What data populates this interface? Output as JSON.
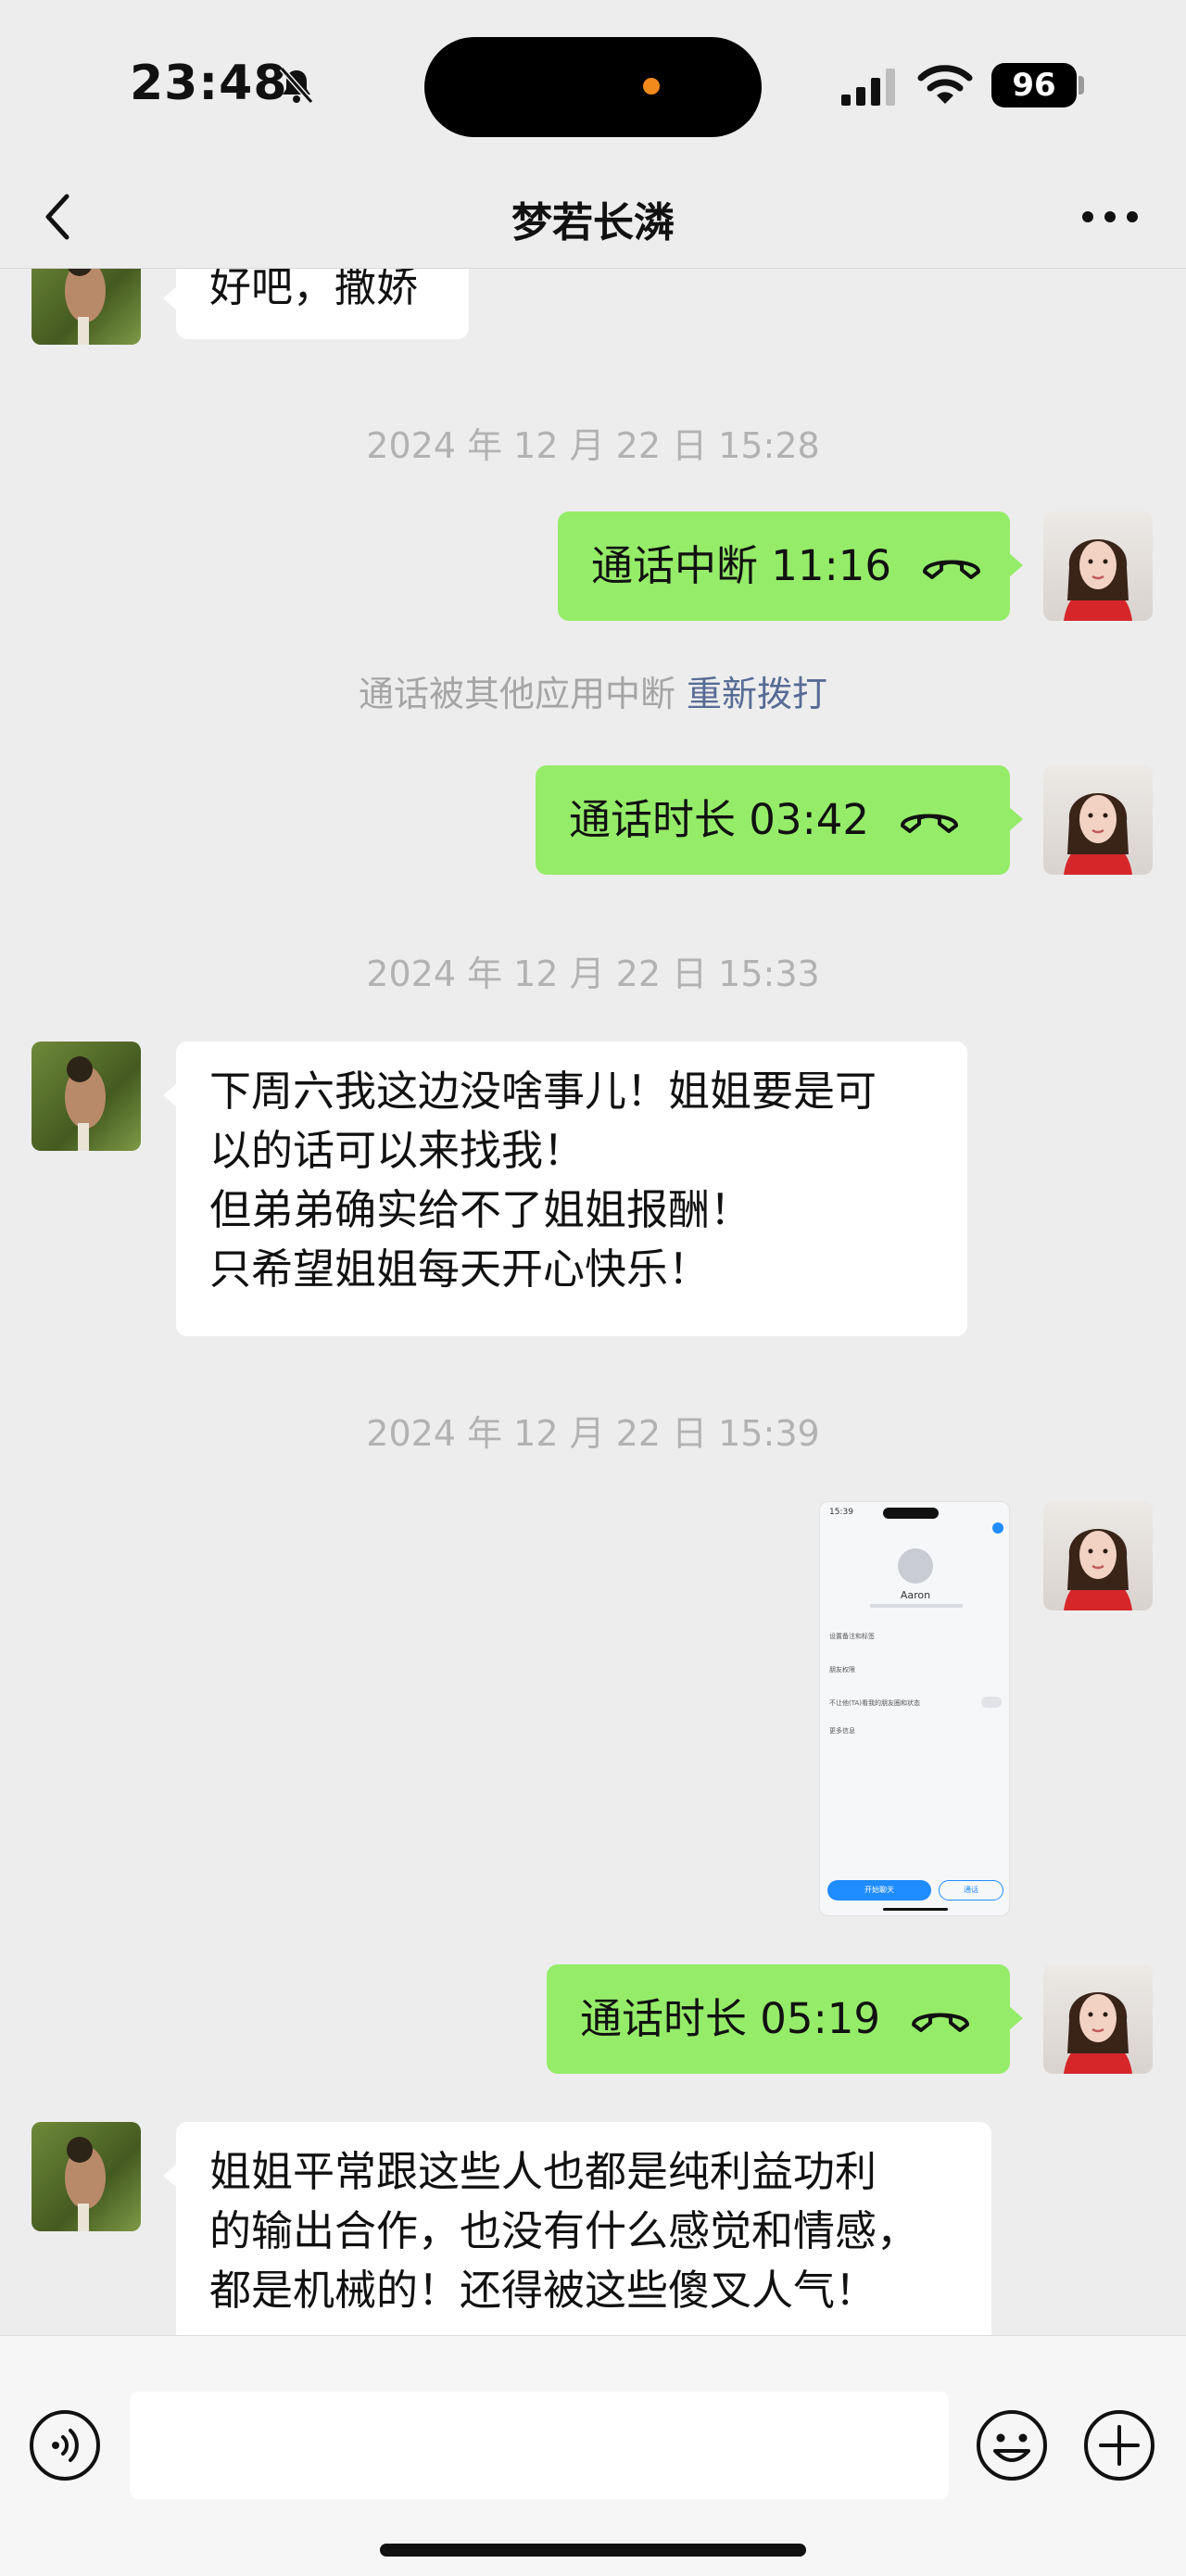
{
  "status_bar": {
    "time": "23:48",
    "battery": "96",
    "icons": [
      "bell-slash-icon",
      "signal-icon",
      "wifi-icon",
      "battery-icon"
    ]
  },
  "nav": {
    "title": "梦若长潾",
    "back_icon": "chevron-left-icon",
    "more_icon": "more-dots-icon"
  },
  "messages": {
    "m0": "好吧，撒娇",
    "ts1": "2024 年 12 月 22 日 15:28",
    "call1": "通话中断 11:16",
    "sys1_text": "通话被其他应用中断",
    "sys1_link": "重新拨打",
    "call2": "通话时长 03:42",
    "ts2": "2024 年 12 月 22 日 15:33",
    "m1_lines": [
      "下周六我这边没啥事儿！姐姐要是可",
      "以的话可以来找我！",
      "但弟弟确实给不了姐姐报酬！",
      "只希望姐姐每天开心快乐！"
    ],
    "ts3": "2024 年 12 月 22 日 15:39",
    "call3": "通话时长 05:19",
    "m2_lines": [
      "姐姐平常跟这些人也都是纯利益功利",
      "的输出合作，也没有什么感觉和情感，",
      "都是机械的！还得被这些傻叉人气！"
    ]
  },
  "thumbnail": {
    "time": "15:39",
    "name": "Aaron",
    "rows": [
      "设置备注和标签",
      "朋友权限",
      "不让他(TA)看我的朋友圈和状态",
      "更多信息"
    ],
    "primary_button": "开始聊天",
    "secondary_button": "通话"
  },
  "input_bar": {
    "placeholder": "",
    "icons": [
      "voice-icon",
      "emoji-icon",
      "plus-icon"
    ]
  },
  "colors": {
    "background": "#ededed",
    "bubble_self": "#95ec69",
    "bubble_other": "#ffffff",
    "link": "#576b95",
    "timestamp": "#b2b2b2"
  }
}
